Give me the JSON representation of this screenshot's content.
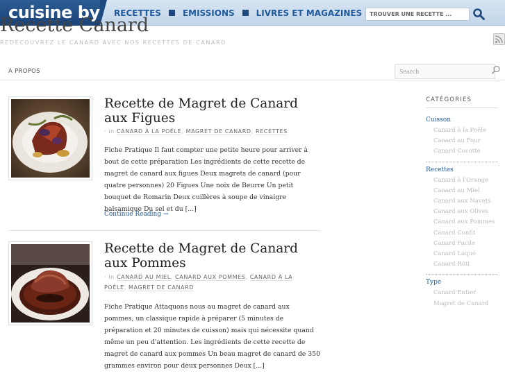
{
  "topbar": {
    "logo": "cuisine by",
    "nav": [
      "RECETTES",
      "EMISSIONS",
      "LIVRES ET MAGAZINES"
    ],
    "search_placeholder": "TROUVER UNE RECETTE ..."
  },
  "site": {
    "title": "Recette Canard",
    "description": "REDÉCOUVREZ LE CANARD AVEC NOS RECETTES DE CANARD"
  },
  "subnav": {
    "apropos": "A PROPOS",
    "search_placeholder": "Search"
  },
  "posts": [
    {
      "title": "Recette de Magret de Canard aux Figues",
      "meta_prefix": "· in",
      "categories": [
        "CANARD À LA POÊLE",
        "MAGRET DE CANARD",
        "RECETTES"
      ],
      "excerpt": "Fiche Pratique Il faut compter une petite heure pour arriver à bout de cette préparation Les ingrédients de cette recette de magret de canard aux figues Deux magrets de canard (pour quatre personnes) 20 Figues Une noix de Beurre Un petit bouquet de Romarin Deux cuillères à soupe de vinaigre balsamique Du sel et du [...]",
      "read_more": "Continue Reading →"
    },
    {
      "title": "Recette de Magret de Canard aux Pommes",
      "meta_prefix": "· in",
      "categories": [
        "CANARD AU MIEL",
        "CANARD AUX POMMES",
        "CANARD À LA POÊLE",
        "MAGRET DE CANARD"
      ],
      "excerpt": "Fiche Pratique Attaquons nous au magret de canard aux pommes, un classique rapide à préparer (5 minutes de préparation et 20 minutes de cuisson) mais qui nécessite quand même un peu d'attention. Les ingrédients de cette recette de magret de canard aux pommes Un beau magret de canard de 350 grammes environ pour deux personnes Deux [...]"
    }
  ],
  "sidebar": {
    "heading": "CATÉGORIES",
    "groups": [
      {
        "name": "Cuisson",
        "items": [
          "Canard à la Poêle",
          "Canard au Four",
          "Canard Cocotte"
        ]
      },
      {
        "name": "Recettes",
        "items": [
          "Canard à l'Orange",
          "Canard au Miel",
          "Canard aux Navets",
          "Canard aux Olives",
          "Canard aux Pommes",
          "Canard Confit",
          "Canard Facile",
          "Canard Laqué",
          "Canard Rôti"
        ]
      },
      {
        "name": "Type",
        "items": [
          "Canard Entier",
          "Magret de Canard"
        ]
      }
    ]
  },
  "colors": {
    "accent": "#1f5a9b",
    "logo_bg": "#1b4378",
    "topbar_bg": "#cfdff0"
  }
}
